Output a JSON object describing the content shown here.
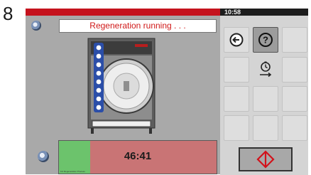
{
  "step_number": "8",
  "clock": "10:58",
  "status": {
    "text": "Regeneration  running . . ."
  },
  "progress": {
    "timer": "46:41",
    "fraction": 0.2,
    "caption": "9.0 Regeneration Process"
  },
  "icons": {
    "top_left": "settings-gauge-icon",
    "bottom_left": "program-gauge-icon",
    "back": "back-arrow-icon",
    "help": "help-icon",
    "cycle": "cycle-stopwatch-icon",
    "stop": "stop-icon"
  },
  "colors": {
    "header_red": "#c5121d",
    "status_text": "#d01818",
    "progress_done": "#6cc36c",
    "progress_remaining": "#c97475",
    "stop_symbol": "#d2121b"
  }
}
